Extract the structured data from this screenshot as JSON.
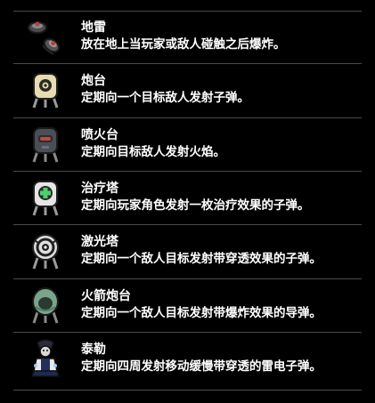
{
  "items": [
    {
      "name": "地雷",
      "desc": "放在地上当玩家或敌人碰触之后爆炸。",
      "icon": "landmine-icon"
    },
    {
      "name": "炮台",
      "desc": "定期向一个目标敌人发射子弹。",
      "icon": "turret-icon"
    },
    {
      "name": "喷火台",
      "desc": "定期向目标敌人发射火焰。",
      "icon": "flamethrower-turret-icon"
    },
    {
      "name": "治疗塔",
      "desc": "定期向玩家角色发射一枚治疗效果的子弹。",
      "icon": "healing-tower-icon"
    },
    {
      "name": "激光塔",
      "desc": "定期向一个敌人目标发射带穿透效果的子弹。",
      "icon": "laser-tower-icon"
    },
    {
      "name": "火箭炮台",
      "desc": "定期向一个敌人目标发射带爆炸效果的导弹。",
      "icon": "rocket-turret-icon"
    },
    {
      "name": "泰勒",
      "desc": "定期向四周发射移动缓慢带穿透的雷电子弹。",
      "icon": "tyler-icon"
    }
  ]
}
